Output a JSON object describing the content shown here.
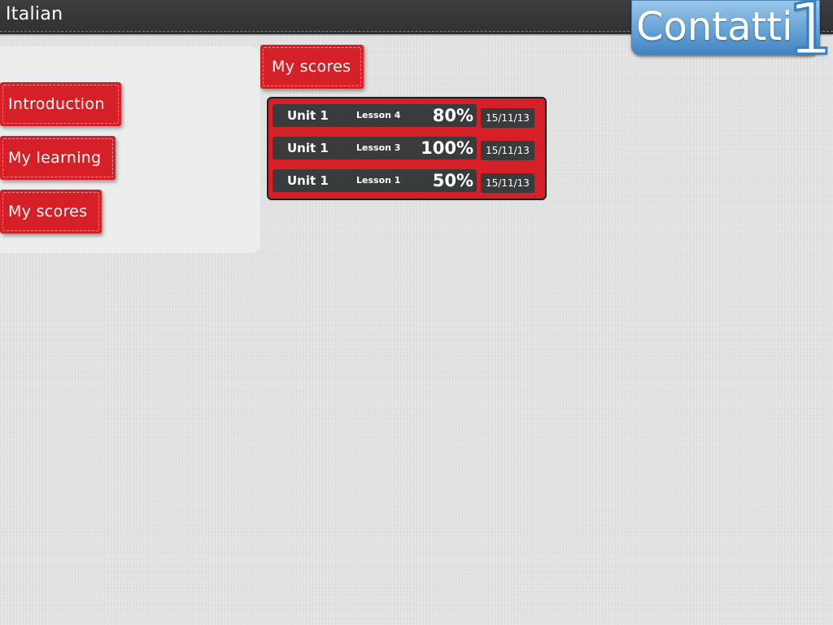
{
  "header": {
    "title": "Italian",
    "logo_text": "Contatti",
    "logo_number": "1"
  },
  "sidebar": {
    "items": [
      {
        "label": "Introduction"
      },
      {
        "label": "My learning"
      },
      {
        "label": "My scores"
      }
    ]
  },
  "main": {
    "heading": "My scores",
    "scores": [
      {
        "unit": "Unit 1",
        "lesson": "Lesson 4",
        "percent": "80%",
        "date": "15/11/13"
      },
      {
        "unit": "Unit 1",
        "lesson": "Lesson 3",
        "percent": "100%",
        "date": "15/11/13"
      },
      {
        "unit": "Unit 1",
        "lesson": "Lesson 1",
        "percent": "50%",
        "date": "15/11/13"
      }
    ]
  },
  "colors": {
    "accent_red": "#d52027",
    "header_dark": "#333537",
    "row_dark": "#3a3b3d",
    "logo_blue": "#6fa9d9"
  }
}
